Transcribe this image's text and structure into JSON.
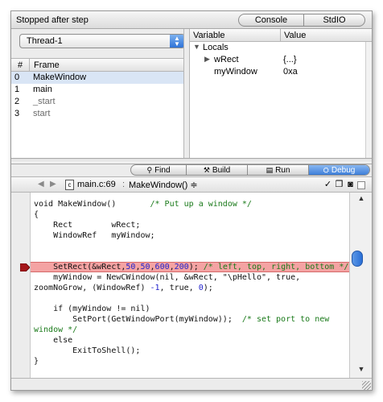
{
  "status": {
    "text": "Stopped after step"
  },
  "top_tabs": [
    "Console",
    "StdIO"
  ],
  "thread": {
    "selected": "Thread-1"
  },
  "frames": {
    "headers": [
      "#",
      "Frame"
    ],
    "rows": [
      {
        "num": "0",
        "name": "MakeWindow"
      },
      {
        "num": "1",
        "name": "main"
      },
      {
        "num": "2",
        "name": "_start"
      },
      {
        "num": "3",
        "name": "start"
      }
    ]
  },
  "variables": {
    "headers": [
      "Variable",
      "Value"
    ],
    "rows": [
      {
        "name": "Locals",
        "value": ""
      },
      {
        "name": "wRect",
        "value": "{...}"
      },
      {
        "name": "myWindow",
        "value": "0xa"
      }
    ]
  },
  "tabs": [
    {
      "icon": "magnifier-icon",
      "label": "Find"
    },
    {
      "icon": "hammer-icon",
      "label": "Build"
    },
    {
      "icon": "run-icon",
      "label": "Run"
    },
    {
      "icon": "bug-icon",
      "label": "Debug"
    }
  ],
  "nav": {
    "file": "main.c:69",
    "separator": ":",
    "function": "MakeWindow() ≑"
  },
  "code": {
    "lines": [
      "void MakeWindow()       /* Put up a window */",
      "{",
      "    Rect        wRect;",
      "    WindowRef   myWindow;",
      "",
      "    SetRect(&wRect,50,50,600,200); /* left, top, right, bottom */",
      "    myWindow = NewCWindow(nil, &wRect, \"\\pHello\", true,",
      "zoomNoGrow, (WindowRef) -1, true, 0);",
      "",
      "    if (myWindow != nil)",
      "        SetPort(GetWindowPort(myWindow));  /* set port to new",
      "window */",
      "    else",
      "        ExitToShell();",
      "}"
    ],
    "current_line_index": 5
  },
  "colors": {
    "pc_highlight": "#f4a3a3",
    "selected_frame": "#d9e5f5",
    "accent_blue": "#3d7ed8",
    "comment_green": "#1a7a1a",
    "number_blue": "#2222cc"
  }
}
